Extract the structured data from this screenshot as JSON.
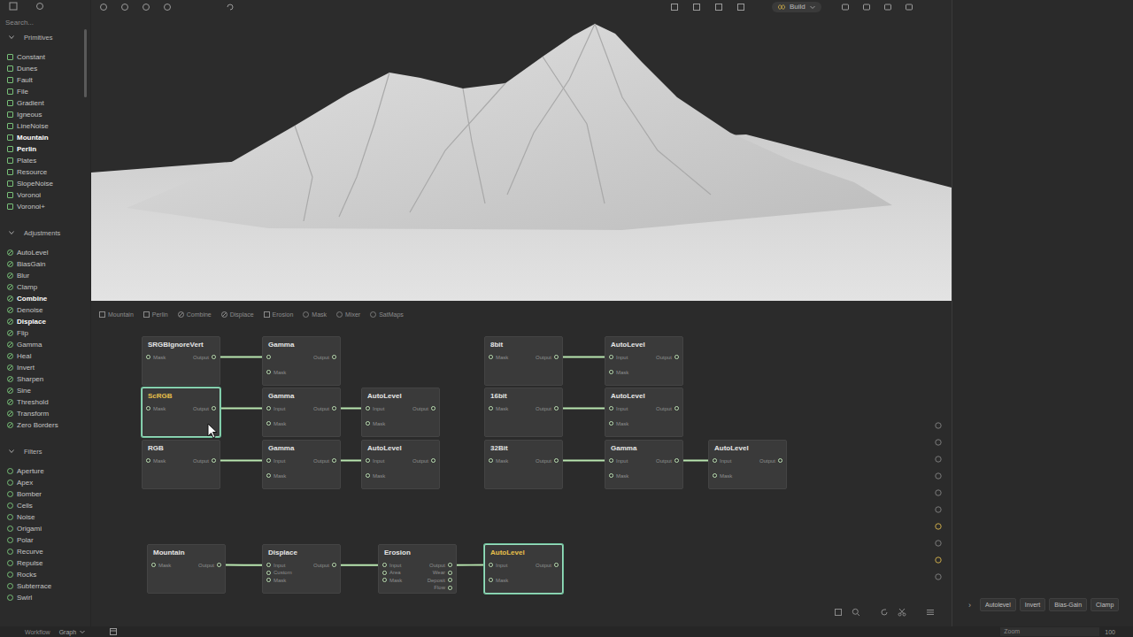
{
  "toolbar": {
    "build_label": "Build"
  },
  "sidebar": {
    "search": {
      "placeholder": "Search..."
    },
    "sections": [
      {
        "title": "Primitives",
        "expanded": true,
        "kind": "square",
        "items": [
          {
            "label": "Constant",
            "active": false
          },
          {
            "label": "Dunes",
            "active": false
          },
          {
            "label": "Fault",
            "active": false
          },
          {
            "label": "File",
            "active": false
          },
          {
            "label": "Gradient",
            "active": false
          },
          {
            "label": "Igneous",
            "active": false
          },
          {
            "label": "LineNoise",
            "active": false
          },
          {
            "label": "Mountain",
            "active": true
          },
          {
            "label": "Perlin",
            "active": true
          },
          {
            "label": "Plates",
            "active": false
          },
          {
            "label": "Resource",
            "active": false
          },
          {
            "label": "SlopeNoise",
            "active": false
          },
          {
            "label": "Voronoi",
            "active": false
          },
          {
            "label": "Voronoi+",
            "active": false
          }
        ]
      },
      {
        "title": "Adjustments",
        "expanded": true,
        "kind": "slash",
        "items": [
          {
            "label": "AutoLevel",
            "active": false
          },
          {
            "label": "BiasGain",
            "active": false
          },
          {
            "label": "Blur",
            "active": false
          },
          {
            "label": "Clamp",
            "active": false
          },
          {
            "label": "Combine",
            "active": true
          },
          {
            "label": "Denoise",
            "active": false
          },
          {
            "label": "Displace",
            "active": true
          },
          {
            "label": "Flip",
            "active": false
          },
          {
            "label": "Gamma",
            "active": false
          },
          {
            "label": "Heal",
            "active": false
          },
          {
            "label": "Invert",
            "active": false
          },
          {
            "label": "Sharpen",
            "active": false
          },
          {
            "label": "Sine",
            "active": false
          },
          {
            "label": "Threshold",
            "active": false
          },
          {
            "label": "Transform",
            "active": false
          },
          {
            "label": "Zero Borders",
            "active": false
          }
        ]
      },
      {
        "title": "Filters",
        "expanded": true,
        "kind": "circle",
        "items": [
          {
            "label": "Aperture",
            "active": false
          },
          {
            "label": "Apex",
            "active": false
          },
          {
            "label": "Bomber",
            "active": false
          },
          {
            "label": "Cells",
            "active": false
          },
          {
            "label": "Noise",
            "active": false
          },
          {
            "label": "Origami",
            "active": false
          },
          {
            "label": "Polar",
            "active": false
          },
          {
            "label": "Recurve",
            "active": false
          },
          {
            "label": "Repulse",
            "active": false
          },
          {
            "label": "Rocks",
            "active": false
          },
          {
            "label": "Subterrace",
            "active": false
          },
          {
            "label": "Swirl",
            "active": false
          }
        ]
      }
    ]
  },
  "graph_tabs": [
    {
      "label": "Mountain",
      "kind": "square"
    },
    {
      "label": "Perlin",
      "kind": "square"
    },
    {
      "label": "Combine",
      "kind": "slash"
    },
    {
      "label": "Displace",
      "kind": "slash"
    },
    {
      "label": "Erosion",
      "kind": "square"
    },
    {
      "label": "Mask",
      "kind": "circle"
    },
    {
      "label": "Mixer",
      "kind": "circle"
    },
    {
      "label": "SatMaps",
      "kind": "circle"
    }
  ],
  "graph": {
    "nodes": [
      {
        "title": "SRGBIgnoreVert",
        "selected": false,
        "inputs": [
          "Mask"
        ],
        "outputs": [
          "Output"
        ]
      },
      {
        "title": "Gamma",
        "selected": false,
        "inputs": [
          "",
          "Mask"
        ],
        "outputs": [
          "Output"
        ]
      },
      {
        "title": "ScRGB",
        "selected": true,
        "inputs": [
          "Mask"
        ],
        "outputs": [
          "Output"
        ]
      },
      {
        "title": "Gamma",
        "selected": false,
        "inputs": [
          "Input",
          "Mask"
        ],
        "outputs": [
          "Output"
        ]
      },
      {
        "title": "AutoLevel",
        "selected": false,
        "inputs": [
          "Input",
          "Mask"
        ],
        "outputs": [
          "Output"
        ]
      },
      {
        "title": "RGB",
        "selected": false,
        "inputs": [
          "Mask"
        ],
        "outputs": [
          "Output"
        ]
      },
      {
        "title": "Gamma",
        "selected": false,
        "inputs": [
          "Input",
          "Mask"
        ],
        "outputs": [
          "Output"
        ]
      },
      {
        "title": "AutoLevel",
        "selected": false,
        "inputs": [
          "Input",
          "Mask"
        ],
        "outputs": [
          "Output"
        ]
      },
      {
        "title": "8bit",
        "selected": false,
        "inputs": [
          "Mask"
        ],
        "outputs": [
          "Output"
        ]
      },
      {
        "title": "AutoLevel",
        "selected": false,
        "inputs": [
          "Input",
          "Mask"
        ],
        "outputs": [
          "Output"
        ]
      },
      {
        "title": "16bit",
        "selected": false,
        "inputs": [
          "Mask"
        ],
        "outputs": [
          "Output"
        ]
      },
      {
        "title": "AutoLevel",
        "selected": false,
        "inputs": [
          "Input",
          "Mask"
        ],
        "outputs": [
          "Output"
        ]
      },
      {
        "title": "32Bit",
        "selected": false,
        "inputs": [
          "Mask"
        ],
        "outputs": [
          "Output"
        ]
      },
      {
        "title": "Gamma",
        "selected": false,
        "inputs": [
          "Input",
          "Mask"
        ],
        "outputs": [
          "Output"
        ]
      },
      {
        "title": "AutoLevel",
        "selected": false,
        "inputs": [
          "Input",
          "Mask"
        ],
        "outputs": [
          "Output"
        ]
      },
      {
        "title": "Mountain",
        "selected": false,
        "inputs": [
          "Mask"
        ],
        "outputs": [
          "Output"
        ]
      },
      {
        "title": "Displace",
        "selected": false,
        "inputs": [
          "Input",
          "Custom",
          "Mask"
        ],
        "outputs": [
          "Output"
        ]
      },
      {
        "title": "Erosion",
        "selected": false,
        "inputs": [
          "Input",
          "Area",
          "Mask"
        ],
        "outputs": [
          "Output",
          "Wear",
          "Deposit",
          "Flow"
        ]
      },
      {
        "title": "AutoLevel",
        "selected": true,
        "inputs": [
          "Input",
          "Mask"
        ],
        "outputs": [
          "Output"
        ]
      }
    ],
    "edges": [
      {
        "from": 0,
        "out": 0,
        "to": 1,
        "in": 0
      },
      {
        "from": 2,
        "out": 0,
        "to": 3,
        "in": 0
      },
      {
        "from": 3,
        "out": 0,
        "to": 4,
        "in": 0
      },
      {
        "from": 5,
        "out": 0,
        "to": 6,
        "in": 0
      },
      {
        "from": 6,
        "out": 0,
        "to": 7,
        "in": 0
      },
      {
        "from": 8,
        "out": 0,
        "to": 9,
        "in": 0
      },
      {
        "from": 10,
        "out": 0,
        "to": 11,
        "in": 0
      },
      {
        "from": 12,
        "out": 0,
        "to": 13,
        "in": 0
      },
      {
        "from": 13,
        "out": 0,
        "to": 14,
        "in": 0
      },
      {
        "from": 15,
        "out": 0,
        "to": 16,
        "in": 0
      },
      {
        "from": 16,
        "out": 0,
        "to": 17,
        "in": 0
      },
      {
        "from": 17,
        "out": 0,
        "to": 18,
        "in": 0
      }
    ]
  },
  "quick_actions": {
    "toggle": "›",
    "buttons": [
      "Autolevel",
      "Invert",
      "Bias-Gain",
      "Clamp"
    ]
  },
  "status_bar": {
    "workflow_label": "Workflow",
    "view": "Graph",
    "zoom_label": "Zoom",
    "zoom": "100"
  }
}
